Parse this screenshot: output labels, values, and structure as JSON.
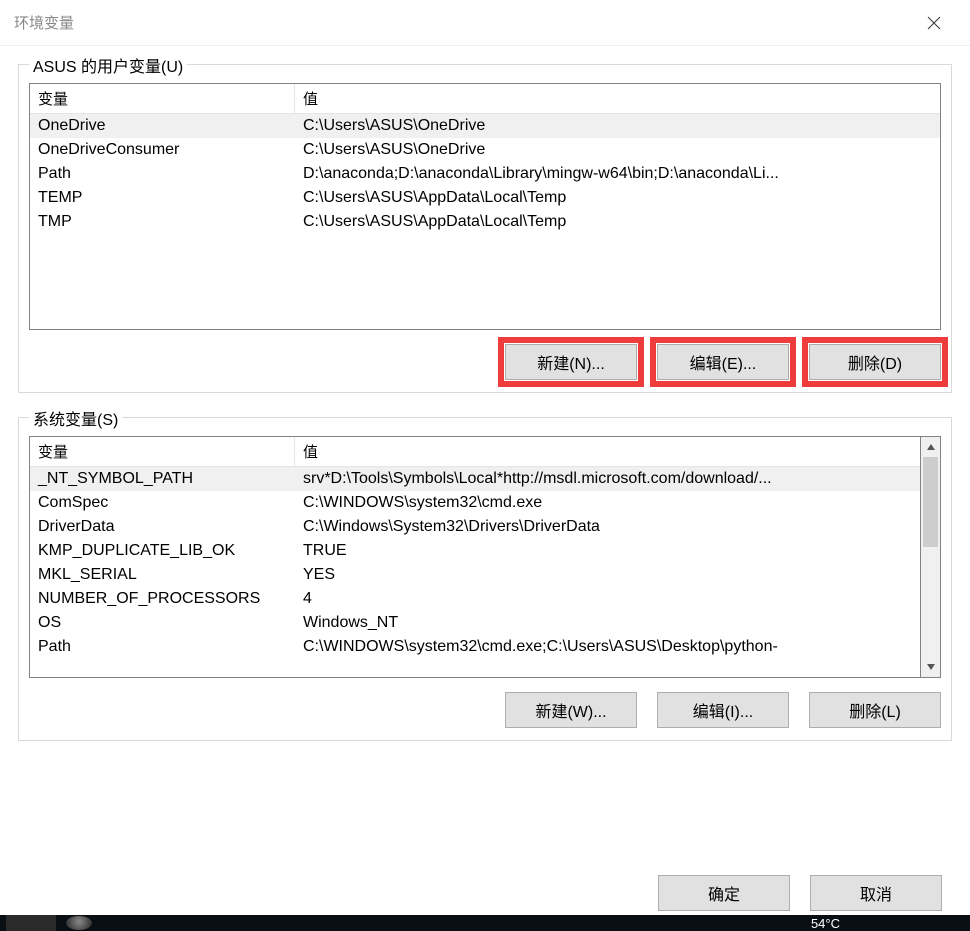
{
  "window": {
    "title": "环境变量"
  },
  "user_section": {
    "label": "ASUS 的用户变量(U)",
    "columns": {
      "name": "变量",
      "value": "值"
    },
    "rows": [
      {
        "name": "OneDrive",
        "value": "C:\\Users\\ASUS\\OneDrive",
        "selected": true
      },
      {
        "name": "OneDriveConsumer",
        "value": "C:\\Users\\ASUS\\OneDrive",
        "selected": false
      },
      {
        "name": "Path",
        "value": "D:\\anaconda;D:\\anaconda\\Library\\mingw-w64\\bin;D:\\anaconda\\Li...",
        "selected": false
      },
      {
        "name": "TEMP",
        "value": "C:\\Users\\ASUS\\AppData\\Local\\Temp",
        "selected": false
      },
      {
        "name": "TMP",
        "value": "C:\\Users\\ASUS\\AppData\\Local\\Temp",
        "selected": false
      }
    ],
    "buttons": {
      "new": "新建(N)...",
      "edit": "编辑(E)...",
      "delete": "删除(D)"
    },
    "highlight_buttons": true
  },
  "system_section": {
    "label": "系统变量(S)",
    "columns": {
      "name": "变量",
      "value": "值"
    },
    "rows": [
      {
        "name": "_NT_SYMBOL_PATH",
        "value": "srv*D:\\Tools\\Symbols\\Local*http://msdl.microsoft.com/download/...",
        "selected": true
      },
      {
        "name": "ComSpec",
        "value": "C:\\WINDOWS\\system32\\cmd.exe",
        "selected": false
      },
      {
        "name": "DriverData",
        "value": "C:\\Windows\\System32\\Drivers\\DriverData",
        "selected": false
      },
      {
        "name": "KMP_DUPLICATE_LIB_OK",
        "value": "TRUE",
        "selected": false
      },
      {
        "name": "MKL_SERIAL",
        "value": "YES",
        "selected": false
      },
      {
        "name": "NUMBER_OF_PROCESSORS",
        "value": "4",
        "selected": false
      },
      {
        "name": "OS",
        "value": "Windows_NT",
        "selected": false
      },
      {
        "name": "Path",
        "value": "C:\\WINDOWS\\system32\\cmd.exe;C:\\Users\\ASUS\\Desktop\\python-",
        "selected": false
      }
    ],
    "buttons": {
      "new": "新建(W)...",
      "edit": "编辑(I)...",
      "delete": "删除(L)"
    }
  },
  "footer": {
    "ok": "确定",
    "cancel": "取消"
  },
  "taskbar": {
    "temperature": "54°C"
  }
}
